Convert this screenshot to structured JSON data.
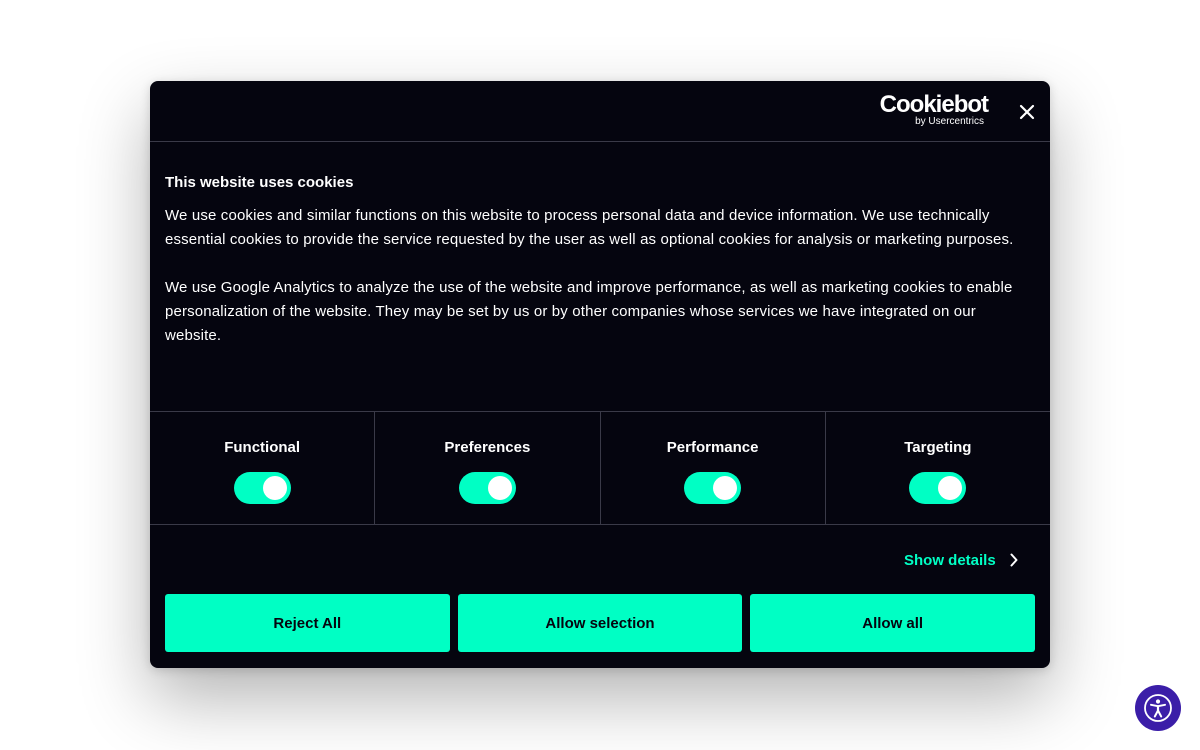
{
  "dialog": {
    "brand": {
      "main": "Cookiebot",
      "sub": "by Usercentrics"
    },
    "close_label": "Close",
    "title": "This website uses cookies",
    "paragraphs": [
      "We use cookies and similar functions on this website to process personal data and device information. We use technically essential cookies to provide the service requested by the user as well as optional cookies for analysis or marketing purposes.",
      "We use Google Analytics to analyze the use of the website and improve performance, as well as marketing cookies to enable personalization of the website. They may be set by us or by other companies whose services we have integrated on our website."
    ],
    "categories": [
      {
        "label": "Functional",
        "enabled": true
      },
      {
        "label": "Preferences",
        "enabled": true
      },
      {
        "label": "Performance",
        "enabled": true
      },
      {
        "label": "Targeting",
        "enabled": true
      }
    ],
    "show_details": "Show details",
    "buttons": {
      "reject": "Reject All",
      "allow_selection": "Allow selection",
      "allow_all": "Allow all"
    }
  },
  "colors": {
    "dialog_bg": "#05050f",
    "accent": "#00ffc4",
    "accessibility_button": "#3b1ea8"
  },
  "icons": {
    "close": "close-icon",
    "show_details": "chevron-right-icon",
    "accessibility": "accessibility-person-icon"
  }
}
